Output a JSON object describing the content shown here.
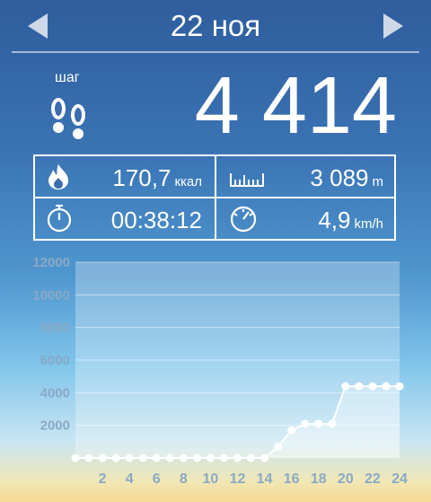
{
  "header": {
    "date": "22 ноя"
  },
  "summary": {
    "steps_label": "шаг",
    "steps": "4 414"
  },
  "stats": {
    "calories": {
      "value": "170,7",
      "unit": "ккал"
    },
    "distance": {
      "value": "3 089",
      "unit": "m"
    },
    "duration": {
      "value": "00:38:12"
    },
    "speed": {
      "value": "4,9",
      "unit": "km/h"
    }
  },
  "chart_data": {
    "type": "line",
    "x": [
      0,
      1,
      2,
      3,
      4,
      5,
      6,
      7,
      8,
      9,
      10,
      11,
      12,
      13,
      14,
      15,
      16,
      17,
      18,
      19,
      20,
      21,
      22,
      23,
      24
    ],
    "values": [
      0,
      0,
      0,
      0,
      0,
      0,
      0,
      0,
      0,
      0,
      0,
      0,
      0,
      0,
      0,
      700,
      1700,
      2100,
      2100,
      2100,
      4400,
      4400,
      4400,
      4400,
      4400
    ],
    "x_tick_labels": [
      "2",
      "4",
      "6",
      "8",
      "10",
      "12",
      "14",
      "16",
      "18",
      "20",
      "22",
      "24"
    ],
    "y_tick_labels": [
      "2000",
      "4000",
      "6000",
      "8000",
      "10000",
      "12000"
    ],
    "ylim": [
      0,
      12000
    ],
    "grid": true
  }
}
